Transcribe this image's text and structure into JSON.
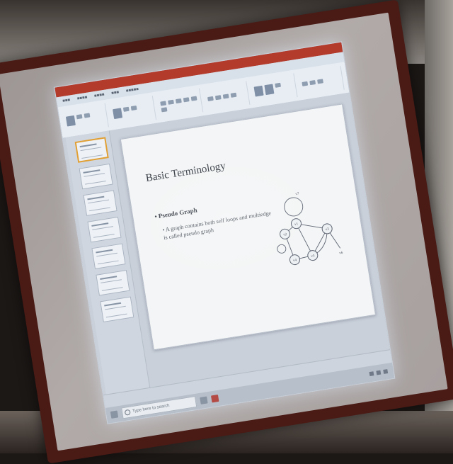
{
  "slide": {
    "title": "Basic Terminology",
    "bullet_heading": "Pseudo Graph",
    "bullet_text": "A graph contains both self loops and multiedge is called pseudo graph"
  },
  "graph": {
    "nodes": [
      "v1",
      "v2",
      "v3",
      "v4",
      "v5",
      "v6",
      "v7"
    ]
  },
  "taskbar": {
    "search_placeholder": "Type here to search"
  },
  "icons": [
    "search-icon",
    "app-icon",
    "powerpoint-icon"
  ]
}
